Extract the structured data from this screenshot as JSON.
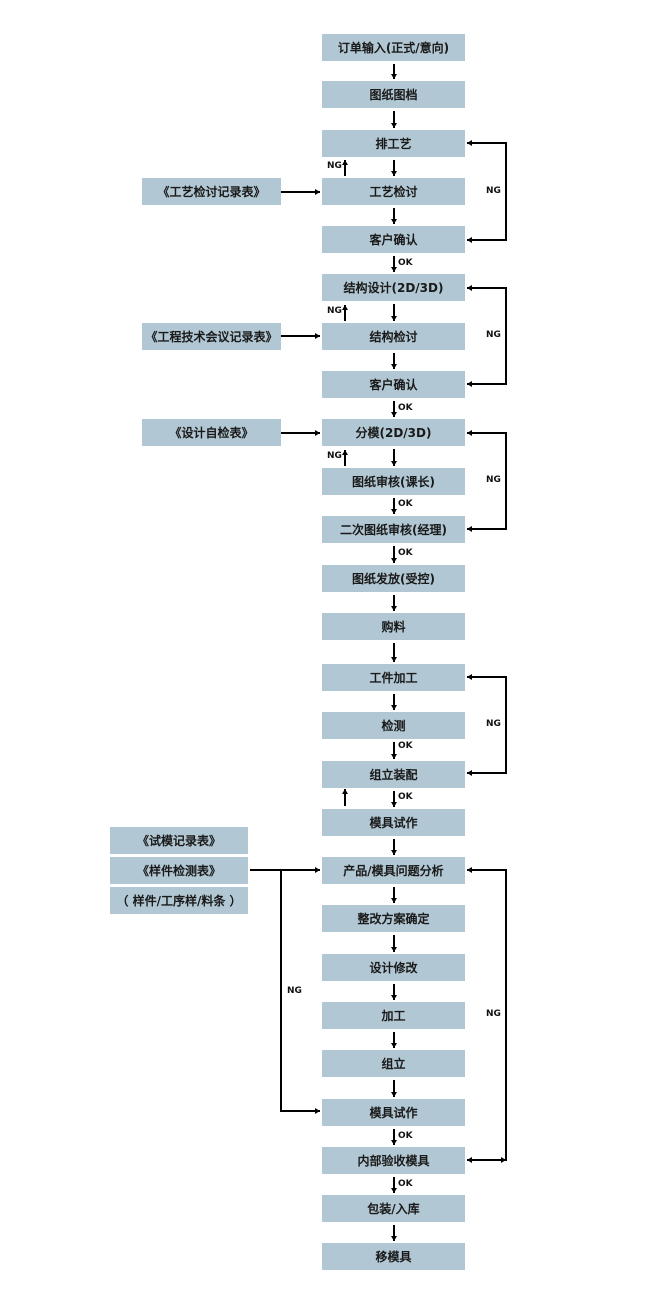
{
  "steps": [
    "订单输入(正式/意向)",
    "图纸图档",
    "排工艺",
    "工艺检讨",
    "客户确认",
    "结构设计(2D/3D)",
    "结构检讨",
    "客户确认",
    "分模(2D/3D)",
    "图纸审核(课长)",
    "二次图纸审核(经理)",
    "图纸发放(受控)",
    "购料",
    "工件加工",
    "检测",
    "组立装配",
    "模具试作",
    "产品/模具问题分析",
    "整改方案确定",
    "设计修改",
    "加工",
    "组立",
    "模具试作",
    "内部验收模具",
    "包装/入库",
    "移模具"
  ],
  "documents": [
    "《工艺检讨记录表》",
    "《工程技术会议记录表》",
    "《设计自检表》",
    "《试模记录表》",
    "《样件检测表》",
    "（ 样件/工序样/料条 ）"
  ],
  "labels": {
    "ng": "NG",
    "ok": "OK"
  },
  "colors": {
    "box": "#b1c7d3",
    "line": "#000000"
  }
}
